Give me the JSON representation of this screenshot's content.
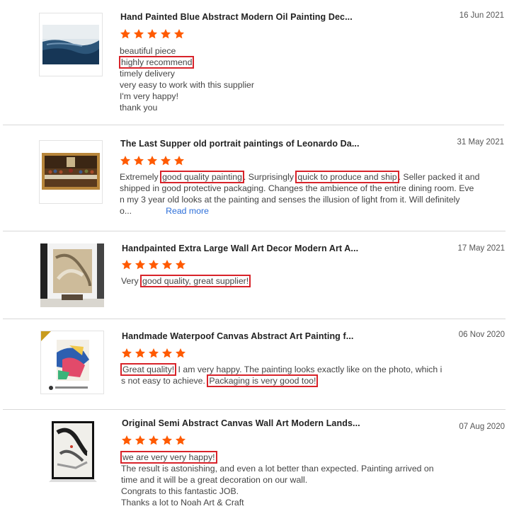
{
  "reviews": [
    {
      "product": "Hand Painted Blue Abstract Modern Oil Painting Dec...",
      "date": "16 Jun 2021",
      "rating": 5,
      "lines": [
        "beautiful piece",
        "highly recommend",
        "timely delivery",
        "very easy to work with this supplier",
        "I'm very happy!",
        "thank you"
      ]
    },
    {
      "product": "The Last Supper old portrait paintings of Leonardo Da...",
      "date": "31 May 2021",
      "rating": 5,
      "l1_a": "Extremely ",
      "l1_hl1": "good quality painting",
      "l1_b": ". Surprisingly ",
      "l1_hl2": "quick to produce and ship",
      "l1_c": ". Seller packed it and",
      "l2": "shipped in good protective packaging. Changes the ambience of the entire dining room. Eve",
      "l3": "n my 3 year old looks at the painting and senses the illusion of light from it. Will definitely",
      "l4": "o...",
      "read_more": "Read more"
    },
    {
      "product": "Handpainted Extra Large Wall Art Decor Modern Art A...",
      "date": "17 May 2021",
      "rating": 5,
      "l1_a": "Very ",
      "l1_hl": "good quality, great supplier!"
    },
    {
      "product": "Handmade Waterpoof Canvas Abstract Art Painting f...",
      "date": "06 Nov 2020",
      "rating": 5,
      "l1_hl": "Great quality!",
      "l1_b": " I am very happy. The painting looks exactly like on the photo, which i",
      "l2_a": "s not easy to achieve. ",
      "l2_hl": "Packaging is very good too!"
    },
    {
      "product": "Original Semi Abstract Canvas Wall Art Modern Lands...",
      "date": "07 Aug 2020",
      "rating": 5,
      "l1_hl": "we are very very happy!",
      "lines": [
        "The result is astonishing, and even a lot better than expected. Painting arrived on",
        "time and it will be a great  decoration on our wall.",
        "Congrats to this fantastic JOB.",
        "Thanks a lot to Noah Art & Craft"
      ]
    }
  ],
  "colors": {
    "star": "#ff5a00",
    "highlight_box": "#d8232a",
    "link": "#2b6ed9"
  }
}
